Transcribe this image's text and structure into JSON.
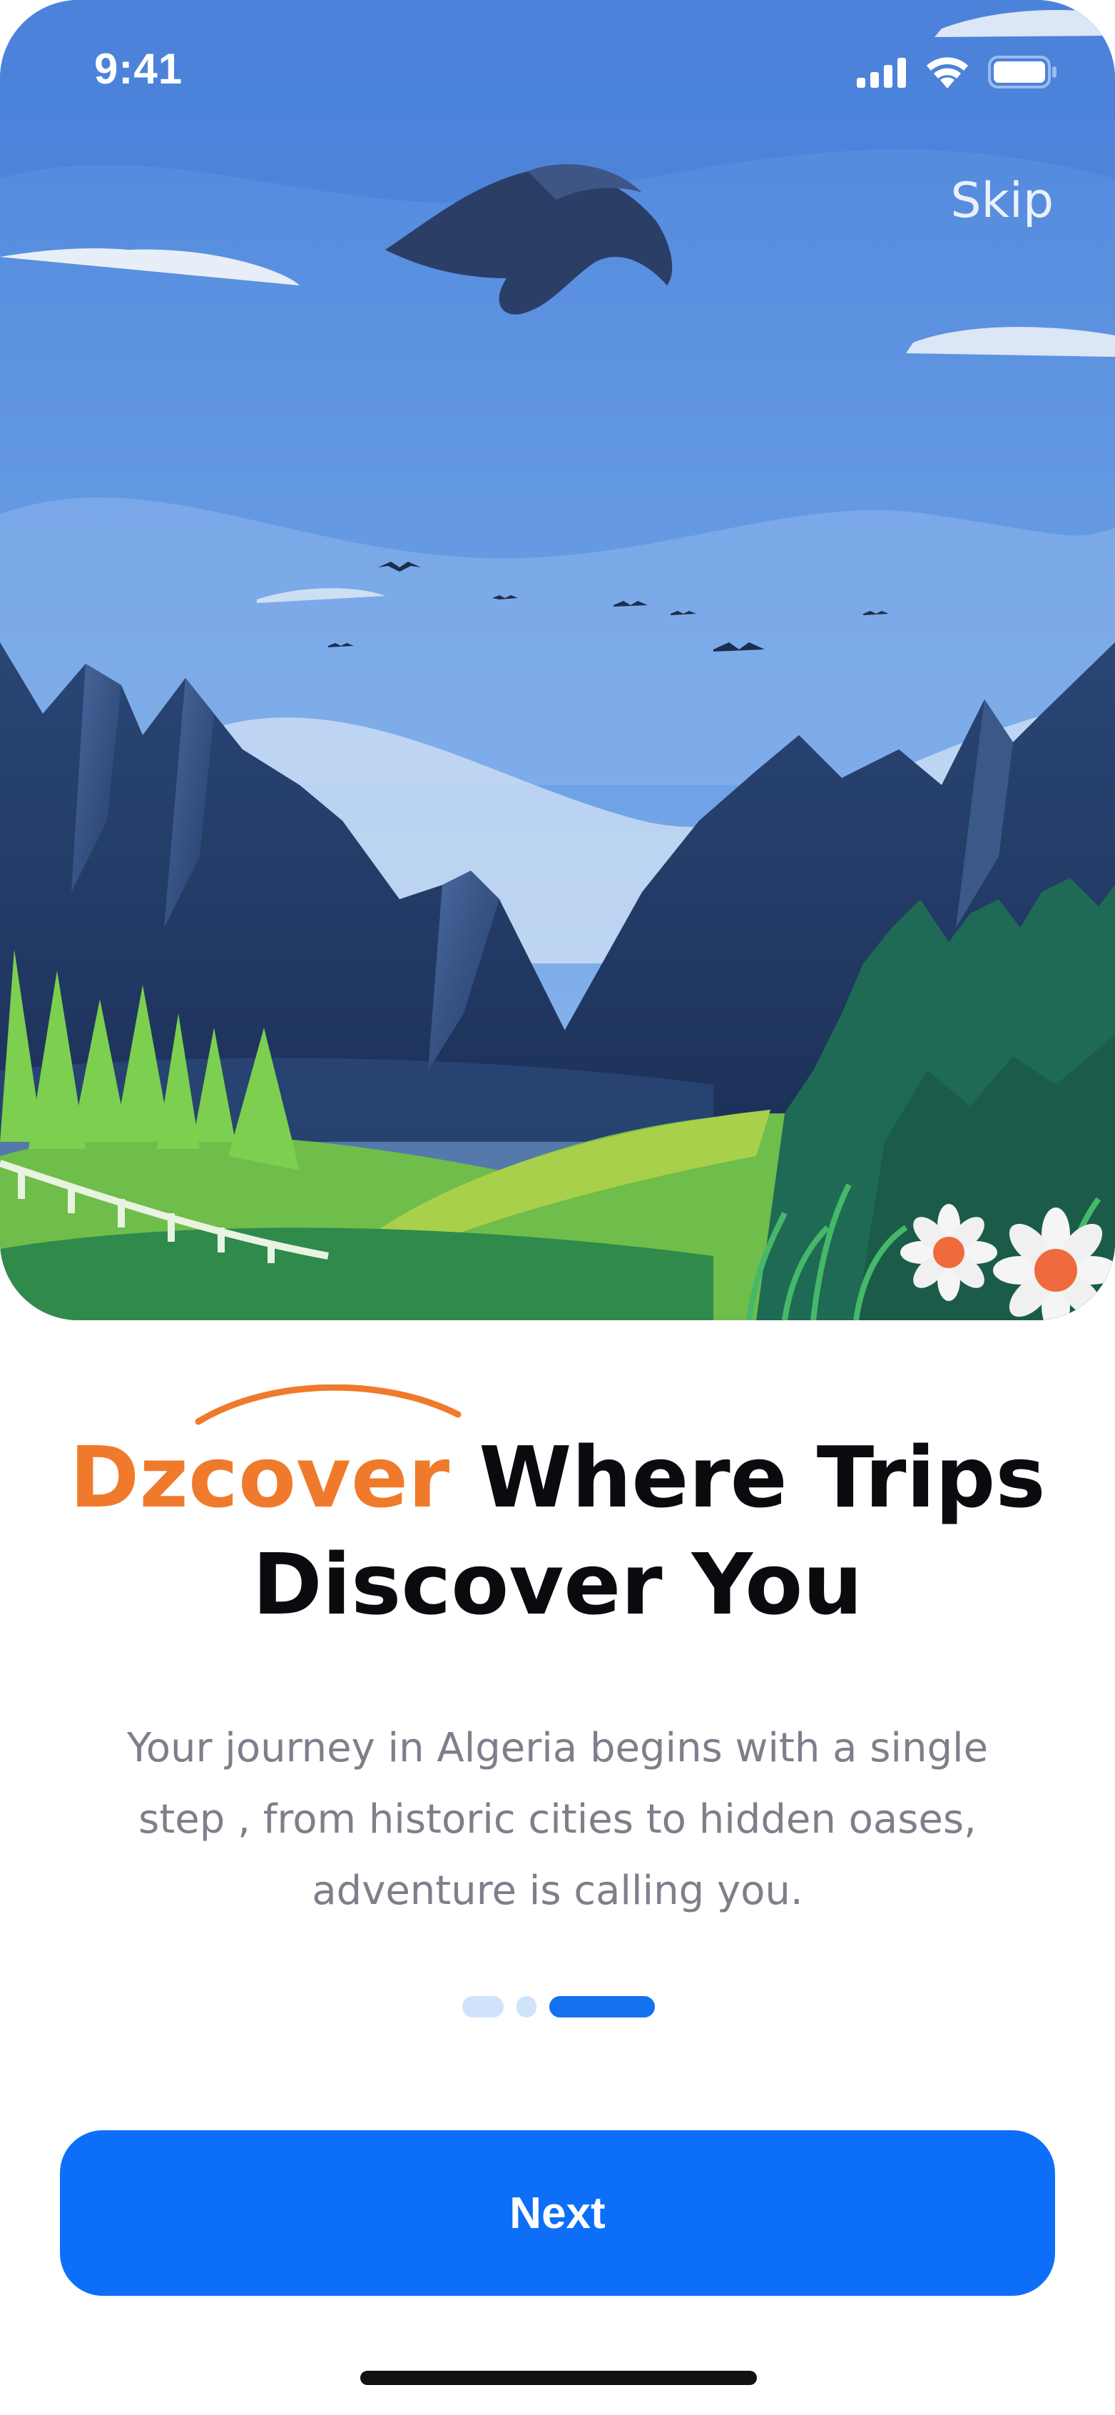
{
  "status_bar": {
    "time": "9:41"
  },
  "hero": {
    "skip_label": "Skip"
  },
  "heading": {
    "brand": "Dzcover",
    "line1_rest": " Where Trips",
    "line2": "Discover You"
  },
  "description": {
    "line1": "Your journey in Algeria begins with a single",
    "line2": "step , from historic cities to hidden oases,",
    "line3": "adventure is calling you."
  },
  "pagination": {
    "total": 3,
    "active_index": 2
  },
  "next_button": {
    "label": "Next"
  },
  "colors": {
    "brand_orange": "#f07a2b",
    "primary_blue": "#0d6ff8",
    "text_dark": "#0b0b0f",
    "text_muted": "#7d808a"
  },
  "icons": [
    "signal-icon",
    "wifi-icon",
    "battery-icon"
  ]
}
